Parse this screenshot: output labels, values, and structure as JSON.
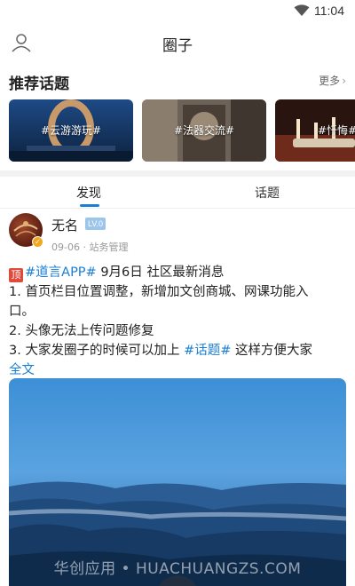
{
  "status_bar": {
    "time": "11:04",
    "wifi_icon": "wifi-icon"
  },
  "header": {
    "title": "圈子",
    "user_icon": "user-icon"
  },
  "recommend": {
    "title": "推荐话题",
    "more_label": "更多",
    "topics": [
      {
        "label": "#云游游玩#"
      },
      {
        "label": "#法器交流#"
      },
      {
        "label": "#忏悔#"
      }
    ]
  },
  "tabs": [
    {
      "label": "发现",
      "active": true
    },
    {
      "label": "话题",
      "active": false
    }
  ],
  "post": {
    "author": "无名",
    "level": "LV.0",
    "meta": "09-06 · 站务管理",
    "badge": "顶",
    "line1_tag": "#道言APP#",
    "line1_text": " 9月6日 社区最新消息",
    "line2": "1. 首页栏目位置调整，新增加文创商城、网课功能入",
    "line3": "口。",
    "line4": "2. 头像无法上传问题修复",
    "line5_pre": "3. 大家发圈子的时候可以加上 ",
    "line5_tag": "#话题#",
    "line5_post": " 这样方便大家",
    "full_text_link": "全文",
    "watermark": "华创应用 • HUACHUANGZS.COM"
  },
  "colors": {
    "accent": "#1a7fd4",
    "badge_red": "#e04a3a",
    "level_bg": "#9cc5ea"
  }
}
